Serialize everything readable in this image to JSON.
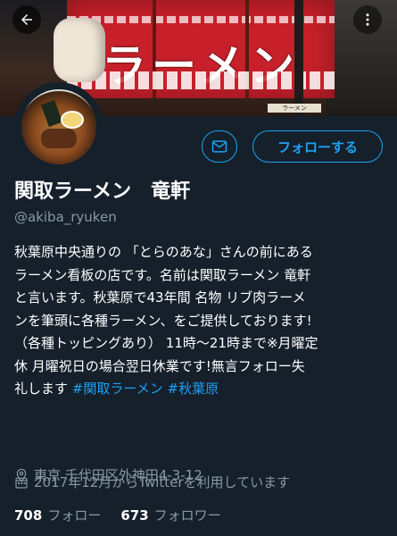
{
  "header": {
    "back_icon": "back-arrow-icon",
    "more_icon": "more-vertical-icon",
    "banner": {
      "noren_text": "ラーメン",
      "sign_text": "ラーメン"
    }
  },
  "actions": {
    "message_icon": "envelope-icon",
    "follow_label": "フォローする",
    "accent_color": "#1da1f2"
  },
  "profile": {
    "name": "関取ラーメン　竜軒",
    "handle": "@akiba_ryuken",
    "bio_lines": [
      "秋葉原中央通りの 「とらのあな」さんの前にある",
      "ラーメン看板の店です。名前は関取ラーメン 竜軒",
      "と言います。秋葉原で43年間 名物 リブ肉ラーメ",
      "ンを筆頭に各種ラーメン、をご提供しております!",
      "（各種トッピングあり） 11時〜21時まで※月曜定",
      "休 月曜祝日の場合翌日休業です!無言フォロー失"
    ],
    "bio_last_text": "礼します ",
    "hashtags": [
      "#関取ラーメン",
      "#秋葉原"
    ],
    "location": "東京 千代田区外神田4-3-12",
    "joined": "2017年12月からTwitterを利用しています"
  },
  "stats": {
    "following_count": "708",
    "following_label": "フォロー",
    "followers_count": "673",
    "followers_label": "フォロワー"
  }
}
